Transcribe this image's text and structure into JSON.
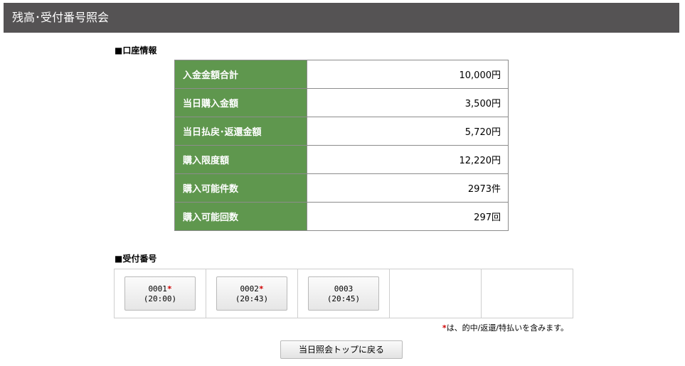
{
  "header": {
    "title": "残高･受付番号照会"
  },
  "account": {
    "section_label": "■口座情報",
    "rows": [
      {
        "label": "入金金額合計",
        "value": "10,000円"
      },
      {
        "label": "当日購入金額",
        "value": "3,500円"
      },
      {
        "label": "当日払戻･返還金額",
        "value": "5,720円"
      },
      {
        "label": "購入限度額",
        "value": "12,220円"
      },
      {
        "label": "購入可能件数",
        "value": "2973件"
      },
      {
        "label": "購入可能回数",
        "value": "297回"
      }
    ]
  },
  "receipt": {
    "section_label": "■受付番号",
    "buttons": [
      {
        "number": "0001",
        "mark": "*",
        "time": "(20:00)"
      },
      {
        "number": "0002",
        "mark": "*",
        "time": "(20:43)"
      },
      {
        "number": "0003",
        "mark": "",
        "time": "(20:45)"
      }
    ],
    "note_mark": "*",
    "note_text": "は、的中/返還/特払いを含みます。"
  },
  "footer": {
    "back_label": "当日照会トップに戻る"
  },
  "colors": {
    "header_bg": "#555354",
    "label_bg": "#5f974e",
    "mark": "#d00000"
  }
}
